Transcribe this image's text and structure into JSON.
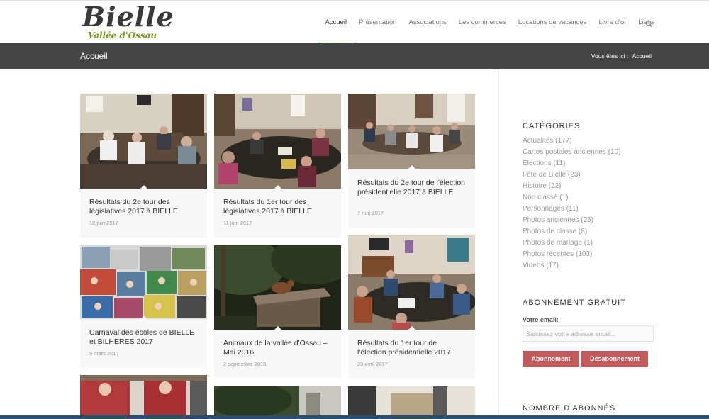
{
  "site": {
    "logo_main": "Bielle",
    "logo_sub": "Vallée d'Ossau"
  },
  "nav": {
    "items": [
      "Accueil",
      "Présentation",
      "Associations",
      "Les commerces",
      "Locations de vacances",
      "Livre d'or",
      "Liens"
    ],
    "active": "Accueil"
  },
  "titlebar": {
    "title": "Accueil",
    "breadcrumb_prefix": "Vous êtes ici :",
    "breadcrumb_current": "Accueil"
  },
  "posts": [
    {
      "title": "Résultats du 2e tour des législatives 2017 à BIELLE",
      "date": "18 juin 2017"
    },
    {
      "title": "Résultats du 1er tour des législatives 2017 à BIELLE",
      "date": "11 juin 2017"
    },
    {
      "title": "Résultats du 2e tour de l'élection présidentielle 2017 à BIELLE",
      "date": "7 mai 2017"
    },
    {
      "title": "Carnaval des écoles de BIELLE et BILHERES 2017",
      "date": "9 mars 2017"
    },
    {
      "title": "Animaux de la vallée d'Ossau – Mai 2016",
      "date": "2 septembre 2016"
    },
    {
      "title": "Résultats du 1er tour de l'élection présidentielle 2017",
      "date": "23 avril 2017"
    }
  ],
  "sidebar": {
    "categories_title": "CATÉGORIES",
    "categories": [
      "Actualités (177)",
      "Cartes postales anciennes (10)",
      "Elections (11)",
      "Fête de Bielle (23)",
      "Histoire (22)",
      "Non classé (1)",
      "Personnages (11)",
      "Photos anciennes (25)",
      "Photos de classe (8)",
      "Photos de mariage (1)",
      "Photos récentes (103)",
      "Vidéos (17)"
    ],
    "subscribe_title": "ABONNEMENT GRATUIT",
    "email_label": "Votre email:",
    "email_placeholder": "Saisissez votre adresse email...",
    "subscribe_button": "Abonnement",
    "unsubscribe_button": "Désabonnement",
    "subscribers_title": "NOMBRE D'ABONNÉS"
  },
  "colors": {
    "accent": "#c25a5a",
    "titlebar_bg": "#444444",
    "logo_green": "#7a9a1e"
  }
}
